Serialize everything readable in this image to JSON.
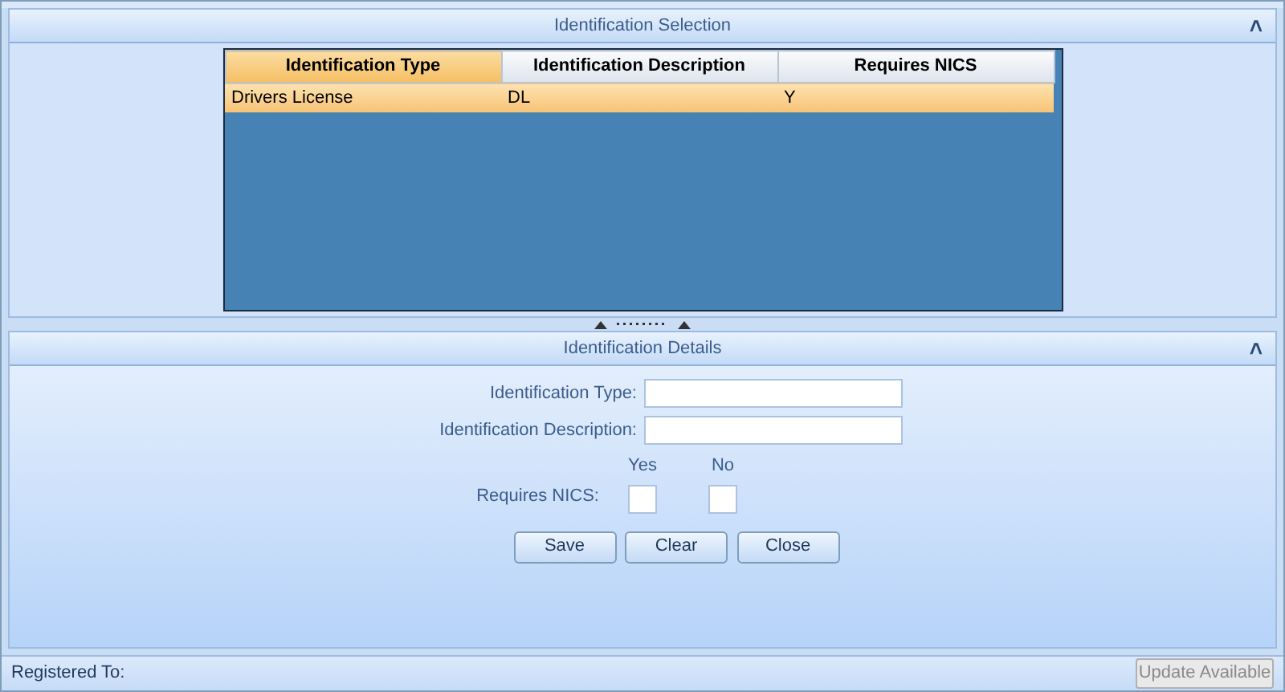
{
  "selection_panel": {
    "title": "Identification Selection",
    "collapse_glyph": "˄",
    "table": {
      "columns": [
        {
          "label": "Identification Type",
          "selected": true
        },
        {
          "label": "Identification Description",
          "selected": false
        },
        {
          "label": "Requires NICS",
          "selected": false
        }
      ],
      "rows": [
        {
          "cells": [
            "Drivers License",
            "DL",
            "Y"
          ],
          "selected": true
        }
      ]
    }
  },
  "details_panel": {
    "title": "Identification Details",
    "collapse_glyph": "˄",
    "fields": [
      {
        "label": "Identification Type:"
      },
      {
        "label": "Identification Description:"
      }
    ],
    "requires_nics": {
      "label": "Requires NICS:",
      "options": [
        {
          "label": "Yes",
          "checked": false
        },
        {
          "label": "No",
          "checked": false
        }
      ]
    },
    "buttons": [
      "Save",
      "Clear",
      "Close"
    ]
  },
  "status_bar": {
    "label": "Registered To:",
    "button": {
      "label": "Update Available",
      "disabled": true
    }
  }
}
